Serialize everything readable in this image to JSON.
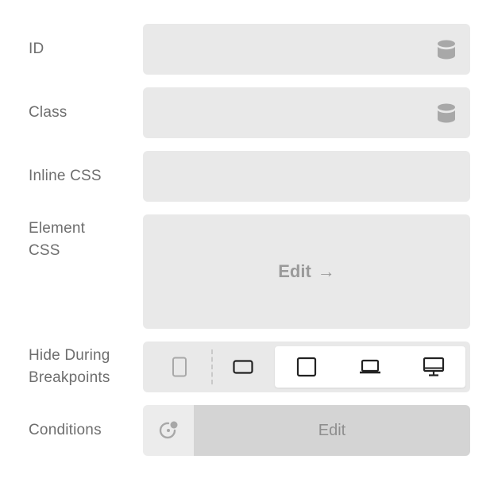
{
  "fields": {
    "id": {
      "label": "ID",
      "value": "",
      "icon": "database-icon"
    },
    "class": {
      "label": "Class",
      "value": "",
      "icon": "database-icon"
    },
    "inline_css": {
      "label": "Inline CSS",
      "value": ""
    },
    "element_css": {
      "label_line1": "Element",
      "label_line2": "CSS",
      "edit_label": "Edit",
      "edit_arrow": "→"
    },
    "hide_breakpoints": {
      "label_line1": "Hide During",
      "label_line2": "Breakpoints",
      "breakpoints": [
        {
          "name": "mobile-portrait",
          "icon": "phone-portrait-icon"
        },
        {
          "name": "mobile-landscape",
          "icon": "phone-landscape-icon"
        },
        {
          "name": "tablet",
          "icon": "tablet-icon"
        },
        {
          "name": "laptop",
          "icon": "laptop-icon"
        },
        {
          "name": "desktop",
          "icon": "desktop-icon"
        }
      ]
    },
    "conditions": {
      "label": "Conditions",
      "edit_label": "Edit",
      "icon": "conditions-icon"
    }
  },
  "colors": {
    "field_bg": "#e9e9e9",
    "label_text": "#6e6e6e",
    "icon_muted": "#a8a8a8",
    "icon_active": "#222222",
    "conditions_edit_bg": "#d4d4d4"
  }
}
